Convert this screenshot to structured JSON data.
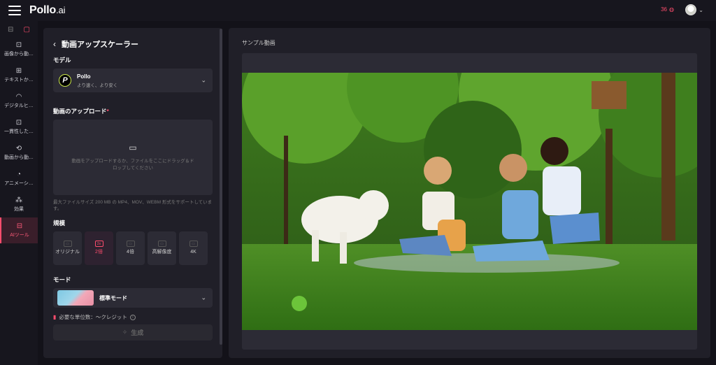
{
  "header": {
    "logo_main": "Pollo",
    "logo_suffix": ".ai",
    "credits": "36",
    "credits_icon": "coin-icon"
  },
  "sidebar": {
    "items": [
      {
        "label": "画像から動…",
        "icon": "image-to-video-icon"
      },
      {
        "label": "テキストか…",
        "icon": "text-to-video-icon"
      },
      {
        "label": "デジタルヒ…",
        "icon": "digital-human-icon"
      },
      {
        "label": "一貫性した…",
        "icon": "consistent-icon"
      },
      {
        "label": "動画から動…",
        "icon": "video-to-video-icon"
      },
      {
        "label": "アニメーシ…",
        "icon": "animation-icon"
      },
      {
        "label": "効果",
        "icon": "effects-icon"
      },
      {
        "label": "AIツール",
        "icon": "ai-tools-icon"
      }
    ]
  },
  "panel": {
    "title": "動画アップスケーラー",
    "model_label": "モデル",
    "model_name": "Pollo",
    "model_desc": "より速く、より安く",
    "upload_label": "動画のアップロード",
    "upload_required": "*",
    "upload_text": "動画をアップロードするか、ファイルをここにドラッグ＆ドロップしてください",
    "upload_hint": "最大ファイルサイズ 200 MB の MP4、MOV、WEBM 形式をサポートしています。",
    "scale_label": "規模",
    "scales": [
      {
        "label": "オリジナル",
        "icon": "▭"
      },
      {
        "label": "2倍",
        "icon": "2x"
      },
      {
        "label": "4倍",
        "icon": "▭"
      },
      {
        "label": "高解像度",
        "icon": "▭"
      },
      {
        "label": "4K",
        "icon": "▭"
      }
    ],
    "selected_scale": "2倍",
    "mode_label": "モード",
    "mode_name": "標準モード",
    "cost_text": "必要な単位数：～クレジット",
    "generate_label": "生成"
  },
  "preview": {
    "label": "サンプル動画"
  },
  "colors": {
    "accent": "#ff4d6d",
    "panel_bg": "#201f28",
    "app_bg": "#131219"
  }
}
